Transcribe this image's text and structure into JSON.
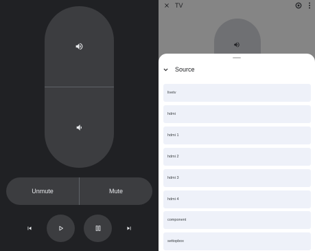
{
  "remote": {
    "volume_up_icon": "volume-up-icon",
    "volume_down_icon": "volume-down-icon",
    "unmute_label": "Unmute",
    "mute_label": "Mute",
    "transport_icons": [
      "skip-previous-icon",
      "play-icon",
      "pause-icon",
      "skip-next-icon"
    ]
  },
  "header": {
    "title": "TV",
    "close_icon": "close-icon",
    "settings_icon": "settings-icon",
    "more_icon": "more-vert-icon"
  },
  "sheet": {
    "title": "Source",
    "collapse_icon": "chevron-down-icon",
    "items": [
      {
        "label": "livetv"
      },
      {
        "label": "hdmi"
      },
      {
        "label": "hdmi 1"
      },
      {
        "label": "hdmi 2"
      },
      {
        "label": "hdmi 3"
      },
      {
        "label": "hdmi 4"
      },
      {
        "label": "component"
      },
      {
        "label": "settopbox"
      }
    ]
  },
  "colors": {
    "background": "#202124",
    "control_surface": "#3c3d40",
    "scrim": "#858585",
    "sheet": "#ffffff",
    "item_background": "#eef1f9"
  }
}
